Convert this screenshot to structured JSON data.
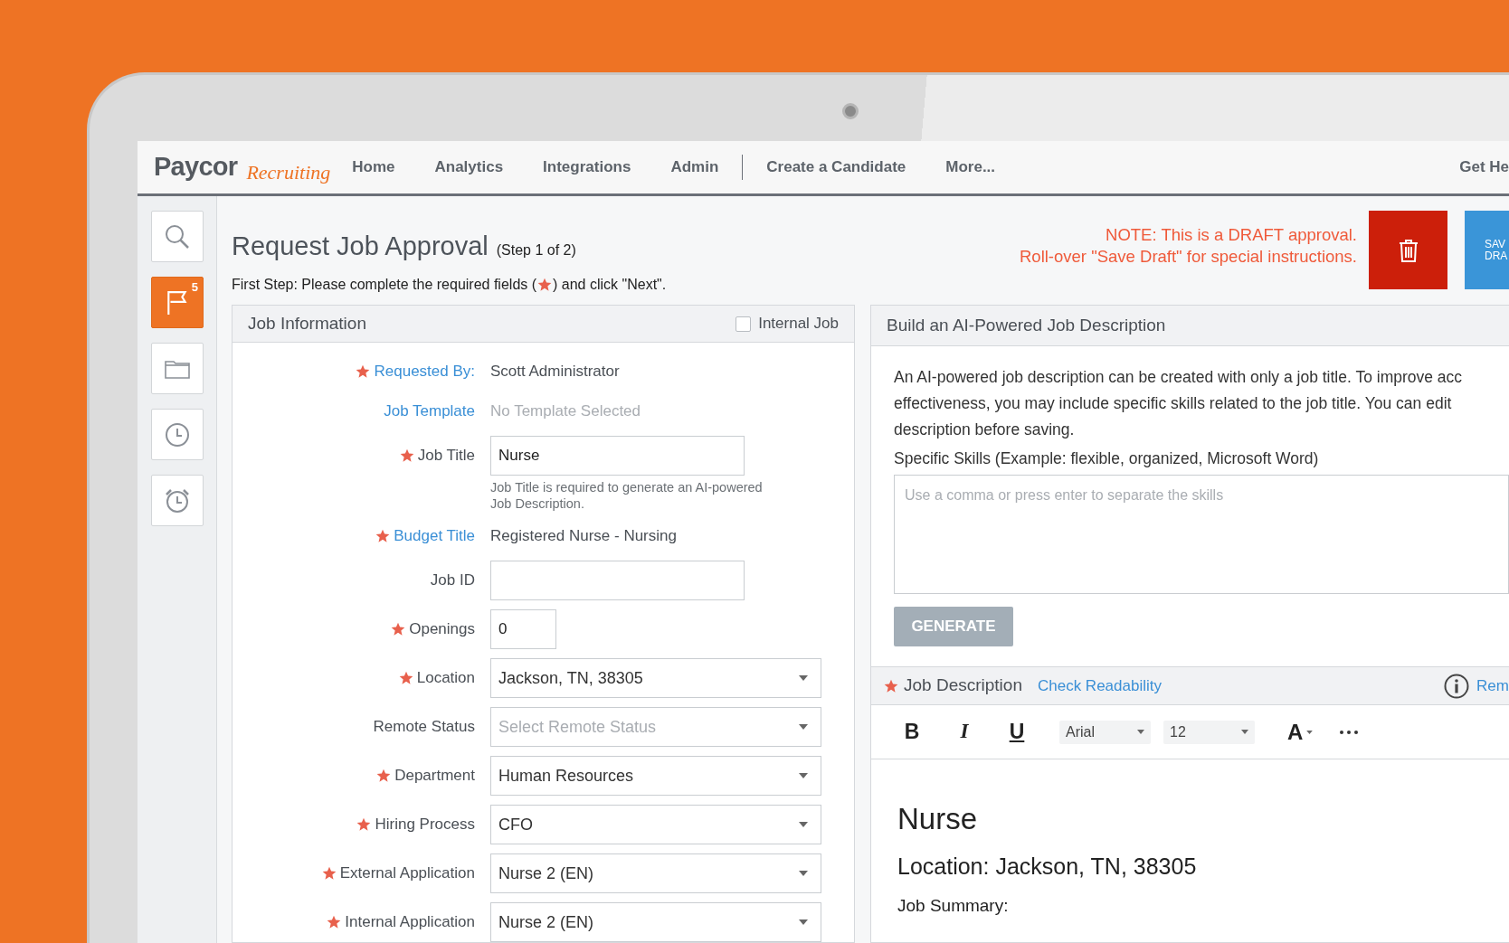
{
  "nav": {
    "logo_word": "Paycor",
    "logo_script": "Recruiting",
    "items": [
      {
        "kind": "link",
        "label": "Home"
      },
      {
        "kind": "link",
        "label": "Analytics"
      },
      {
        "kind": "link",
        "label": "Integrations"
      },
      {
        "kind": "link",
        "label": "Admin"
      },
      {
        "kind": "separator"
      },
      {
        "kind": "link",
        "label": "Create a Candidate"
      },
      {
        "kind": "link",
        "label": "More..."
      }
    ],
    "right_link": "Get He"
  },
  "sidebar": {
    "items": [
      {
        "kind": "search",
        "selected": false
      },
      {
        "kind": "flag",
        "selected": true,
        "badge": "5"
      },
      {
        "kind": "folder",
        "selected": false
      },
      {
        "kind": "clock",
        "selected": false
      },
      {
        "kind": "alarm",
        "selected": false
      }
    ]
  },
  "header": {
    "title": "Request Job Approval",
    "step": "(Step 1 of 2)",
    "instruction_before": "First Step: Please complete the required fields (",
    "instruction_after": ") and click \"Next\".",
    "note_lines": [
      "NOTE: This is a DRAFT approval.",
      "Roll-over \"Save Draft\" for special instructions."
    ],
    "save_button_lines": [
      "SAV",
      "DRA"
    ]
  },
  "job_information": {
    "title": "Job Information",
    "internal_job": {
      "label": "Internal Job",
      "checked": false
    },
    "rows": [
      {
        "label": "Requested By:",
        "required": true,
        "link": true,
        "kind": "text",
        "value": "Scott Administrator"
      },
      {
        "label": "Job Template",
        "required": false,
        "link": true,
        "kind": "text",
        "placeholder": "No Template Selected"
      },
      {
        "label": "Job Title",
        "required": true,
        "link": false,
        "kind": "input",
        "value": "Nurse",
        "help": "Job Title is required to generate an AI-powered Job Description."
      },
      {
        "label": "Budget Title",
        "required": true,
        "link": true,
        "kind": "text",
        "value": "Registered Nurse - Nursing"
      },
      {
        "label": "Job ID",
        "required": false,
        "link": false,
        "kind": "input"
      },
      {
        "label": "Openings",
        "required": true,
        "link": false,
        "kind": "number",
        "value": "0"
      },
      {
        "label": "Location",
        "required": true,
        "link": false,
        "kind": "select",
        "value": "Jackson, TN, 38305"
      },
      {
        "label": "Remote Status",
        "required": false,
        "link": false,
        "kind": "select",
        "placeholder": "Select Remote Status"
      },
      {
        "label": "Department",
        "required": true,
        "link": false,
        "kind": "select",
        "value": "Human Resources"
      },
      {
        "label": "Hiring Process",
        "required": true,
        "link": false,
        "kind": "select",
        "value": "CFO"
      },
      {
        "label": "External Application",
        "required": true,
        "link": false,
        "kind": "select",
        "value": "Nurse 2 (EN)"
      },
      {
        "label": "Internal Application",
        "required": true,
        "link": false,
        "kind": "select",
        "value": "Nurse 2 (EN)"
      }
    ]
  },
  "ai_builder": {
    "title": "Build an AI-Powered Job Description",
    "description_lines": [
      "An AI-powered job description can be created with only a job title. To improve acc",
      "effectiveness, you may include specific skills related to the job title. You can edit",
      "description before saving."
    ],
    "skills_label": "Specific Skills (Example: flexible, organized, Microsoft Word)",
    "skills_placeholder": "Use a comma or press enter to separate the skills",
    "generate_button": {
      "label": "GENERATE",
      "disabled": true
    }
  },
  "job_description": {
    "label": "Job Description",
    "required": true,
    "link": "Check Readability",
    "right_link": "Rem",
    "toolbar": [
      {
        "kind": "bold",
        "label": "B"
      },
      {
        "kind": "italic",
        "label": "I"
      },
      {
        "kind": "underline",
        "label": "U"
      },
      {
        "kind": "font_select",
        "label": "Arial"
      },
      {
        "kind": "size_select",
        "label": "12"
      },
      {
        "kind": "color",
        "label": "A"
      },
      {
        "kind": "more"
      }
    ],
    "content": [
      {
        "kind": "h1",
        "text": "Nurse"
      },
      {
        "kind": "h2",
        "text": "Location: Jackson, TN, 38305"
      },
      {
        "kind": "p",
        "text": "Job Summary:"
      }
    ]
  }
}
